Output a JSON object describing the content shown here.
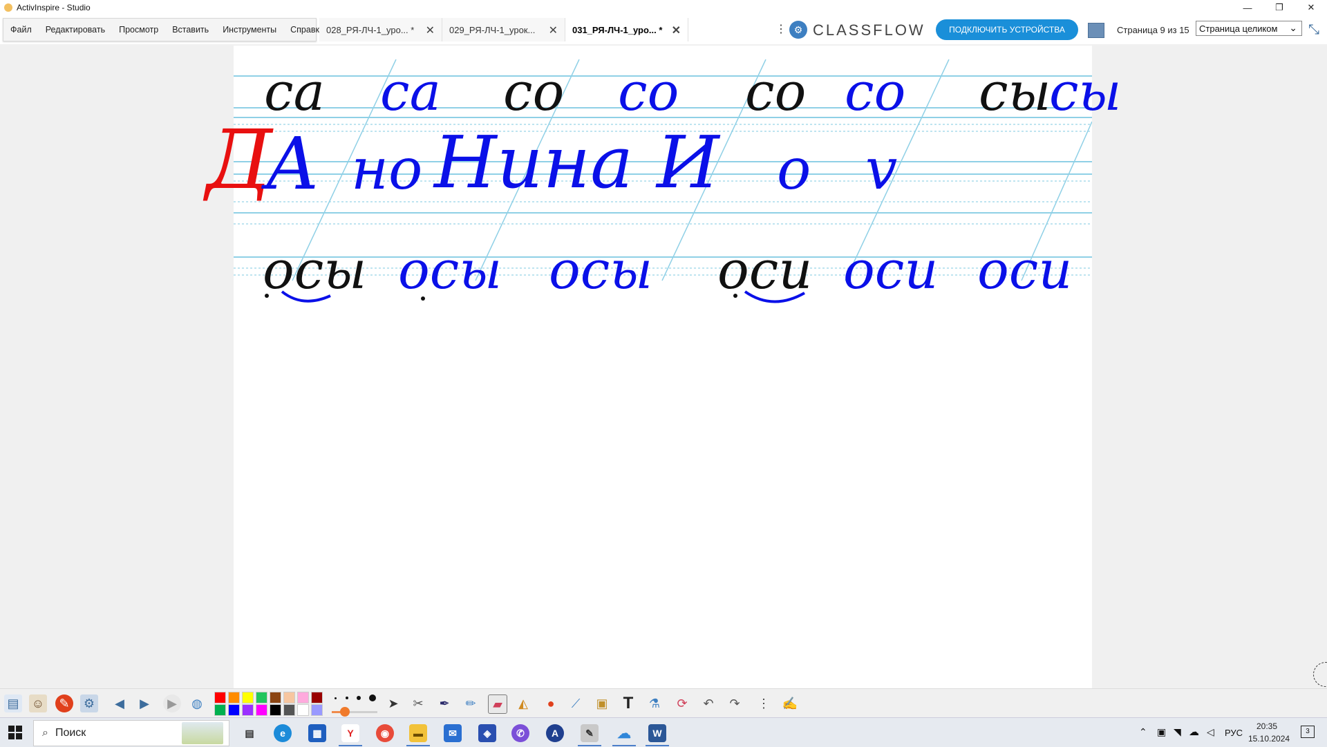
{
  "window": {
    "title": "ActivInspire - Studio",
    "minimize": "—",
    "restore": "❐",
    "close": "✕"
  },
  "menu": [
    "Файл",
    "Редактировать",
    "Просмотр",
    "Вставить",
    "Инструменты",
    "Справка"
  ],
  "tabs": [
    {
      "label": "028_РЯ-ЛЧ-1_уро... *",
      "active": false
    },
    {
      "label": "029_РЯ-ЛЧ-1_урок...",
      "active": false
    },
    {
      "label": "031_РЯ-ЛЧ-1_уро... *",
      "active": true
    }
  ],
  "tab_close": "✕",
  "header": {
    "kebab": "⋮",
    "logo_text": "CLASSFLOW",
    "connect_button": "ПОДКЛЮЧИТЬ УСТРОЙСТВА",
    "page_counter": "Страница 9 из 15",
    "zoom_value": "Страница целиком",
    "zoom_chevron": "⌄",
    "fullscreen": "⤡"
  },
  "canvas": {
    "row1": [
      "са",
      "са",
      "со",
      "со",
      "со",
      "со",
      "сы",
      "сы"
    ],
    "row2": [
      "А",
      "но",
      "Нина",
      "И",
      "о",
      "v"
    ],
    "row2_red": "Д",
    "row3": [
      "осы",
      "осы",
      "осы",
      "оси",
      "оси",
      "оси"
    ],
    "ink_black": "#111111",
    "ink_blue": "#0a10e8",
    "ink_red": "#e81010",
    "ruling_color": "#8fd0e6"
  },
  "toolbar": {
    "colors": [
      "#ff0000",
      "#ff8c00",
      "#ffff00",
      "#22c55e",
      "#8b4513",
      "#f7c6a0",
      "#990000",
      "#00b050",
      "#0000ff",
      "#9b30ff",
      "#ff00ff",
      "#000000",
      "#555555",
      "#ffffff",
      "#9999ff",
      "#ffaadd"
    ],
    "icons": [
      "flipchart-browser-icon",
      "user-icon",
      "pen-red-icon",
      "settings-icon",
      "prev-page-icon",
      "next-page-icon",
      "play-icon",
      "globe-icon",
      "select-icon",
      "tools-icon",
      "pen-icon",
      "highlighter-icon",
      "eraser-icon",
      "fill-icon",
      "shape-icon",
      "connector-icon",
      "resources-icon",
      "text-icon",
      "clear-icon",
      "reset-icon",
      "undo-icon",
      "redo-icon",
      "more-icon",
      "desk-icon"
    ]
  },
  "taskbar": {
    "search_placeholder": "Поиск",
    "lang": "РУС",
    "time": "20:35",
    "date": "15.10.2024",
    "notifications": "3",
    "apps": [
      {
        "name": "task-view",
        "color": "#333333",
        "glyph": "▤"
      },
      {
        "name": "edge",
        "color": "#1c8bd9",
        "glyph": "e"
      },
      {
        "name": "store",
        "color": "#1f5fbf",
        "glyph": "▦"
      },
      {
        "name": "yandex",
        "color": "#ffffff",
        "glyph": "Y"
      },
      {
        "name": "chrome",
        "color": "#e84b3a",
        "glyph": "◉"
      },
      {
        "name": "explorer",
        "color": "#f2c23a",
        "glyph": "▬"
      },
      {
        "name": "mail",
        "color": "#2a6fd1",
        "glyph": "✉"
      },
      {
        "name": "app-blue",
        "color": "#2a4fb0",
        "glyph": "◈"
      },
      {
        "name": "viber",
        "color": "#7b4fd8",
        "glyph": "✆"
      },
      {
        "name": "app-a",
        "color": "#1f3f8f",
        "glyph": "A"
      },
      {
        "name": "activinspire",
        "color": "#c9c9c9",
        "glyph": "✎"
      },
      {
        "name": "onedrive",
        "color": "#2f86d9",
        "glyph": "☁"
      },
      {
        "name": "word",
        "color": "#2b5797",
        "glyph": "W"
      }
    ]
  }
}
